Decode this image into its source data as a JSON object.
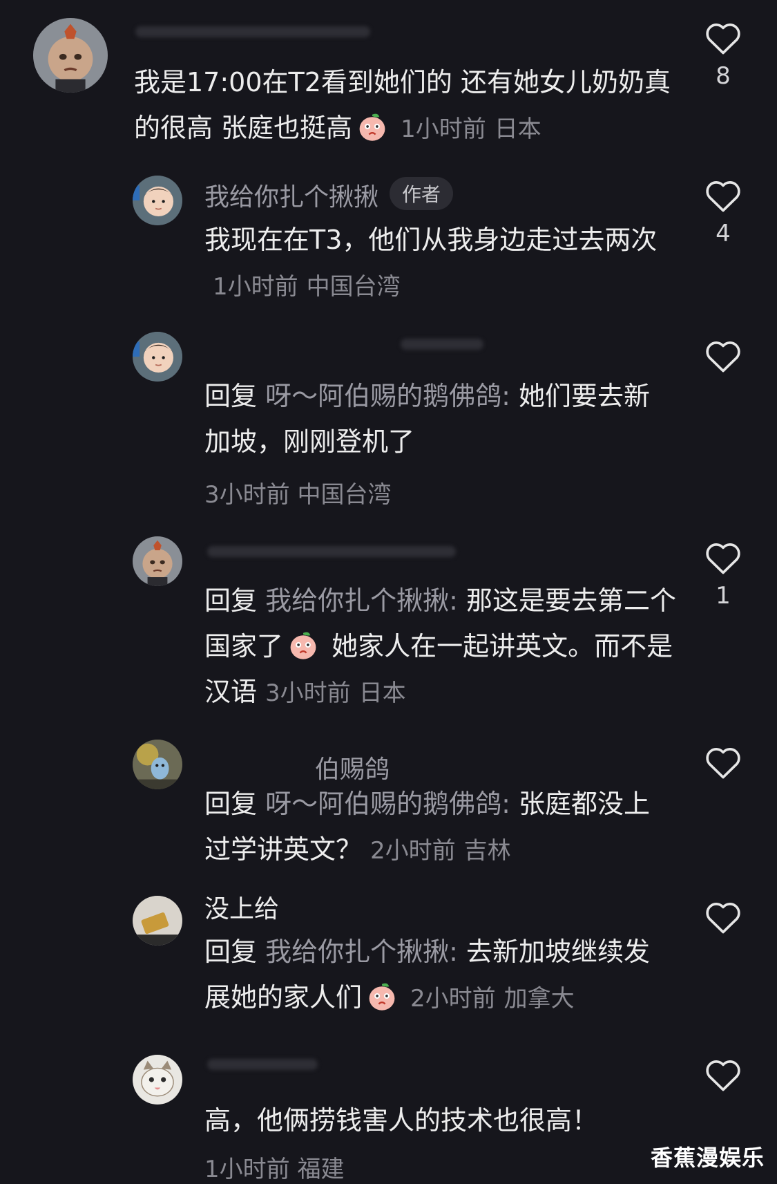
{
  "comments": [
    {
      "username_partial": "我... 17:00 T2",
      "text": "我是17:00在T2看到她们的 还有她女儿奶奶真的很高 张庭也挺高",
      "time": "1小时前",
      "location": "日本",
      "likes": "8",
      "emoji": "peach-face"
    }
  ],
  "replies": [
    {
      "username": "我给你扎个揪揪",
      "badge": "作者",
      "text": "我现在在T3，他们从我身边走过去两次",
      "time": "1小时前",
      "location": "中国台湾",
      "likes": "4"
    },
    {
      "reply_prefix": "回复",
      "reply_target": "呀～阿伯赐的鹅佛鸽:",
      "text": " 她们要去新加坡，刚刚登机了",
      "time": "3小时前",
      "location": "中国台湾",
      "likes": ""
    },
    {
      "reply_prefix": "回复",
      "reply_target": "我给你扎个揪揪:",
      "text": " 那这是要去第二个国家了",
      "text2": " 她家人在一起讲英文。而不是汉语",
      "time": "3小时前",
      "location": "日本",
      "likes": "1"
    },
    {
      "username_partial": "伯赐鸽",
      "reply_prefix": "回复",
      "reply_target": "呀～阿伯赐的鹅佛鸽:",
      "text": " 张庭都没上过学讲英文？",
      "time": "2小时前",
      "location": "吉林",
      "likes": ""
    },
    {
      "username_partial": "没上给",
      "reply_prefix": "回复",
      "reply_target": "我给你扎个揪揪:",
      "text": " 去新加坡继续发展她的家人们",
      "time": "2小时前",
      "location": "加拿大",
      "likes": ""
    },
    {
      "text": "高，他俩捞钱害人的技术也很高！",
      "time": "1小时前",
      "location": "福建",
      "likes": ""
    }
  ],
  "watermark": "香蕉漫娱乐",
  "colors": {
    "background": "#16161c",
    "text": "#ededed",
    "muted": "#9a9aa3"
  }
}
